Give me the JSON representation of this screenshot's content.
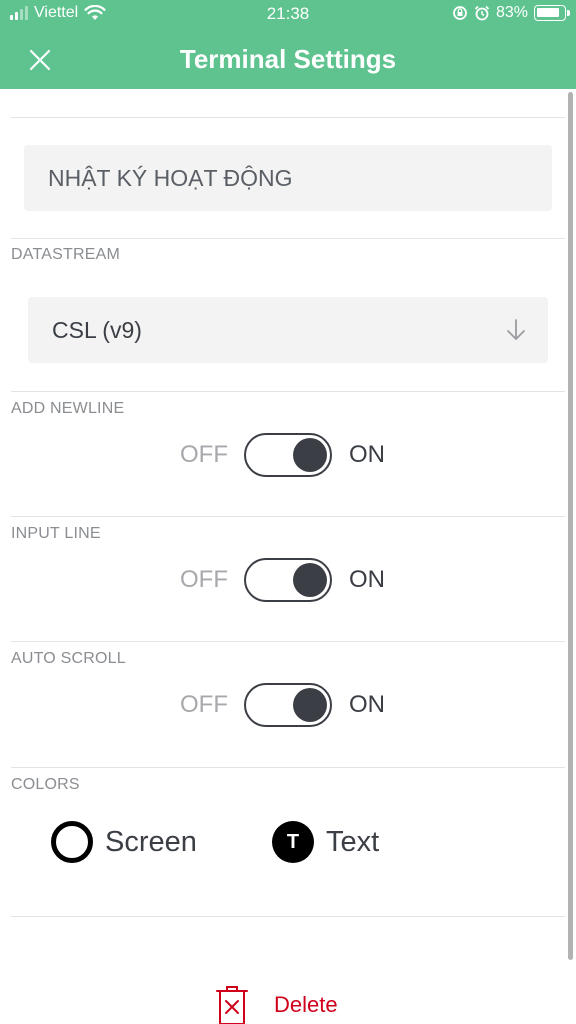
{
  "status_bar": {
    "carrier": "Viettel",
    "time": "21:38",
    "battery_text": "83%"
  },
  "header": {
    "title": "Terminal Settings",
    "background_color": "#5ec38f"
  },
  "name_field": {
    "value": "NHẬT KÝ HOẠT ĐỘNG"
  },
  "datastream": {
    "label": "DATASTREAM",
    "selected": "CSL (v9)"
  },
  "toggles": [
    {
      "label": "ADD NEWLINE",
      "off_text": "OFF",
      "on_text": "ON",
      "state": "on"
    },
    {
      "label": "INPUT LINE",
      "off_text": "OFF",
      "on_text": "ON",
      "state": "on"
    },
    {
      "label": "AUTO SCROLL",
      "off_text": "OFF",
      "on_text": "ON",
      "state": "on"
    }
  ],
  "colors": {
    "label": "COLORS",
    "screen_label": "Screen",
    "text_label": "Text",
    "text_swatch_letter": "T"
  },
  "delete": {
    "label": "Delete",
    "color": "#d0021b"
  }
}
